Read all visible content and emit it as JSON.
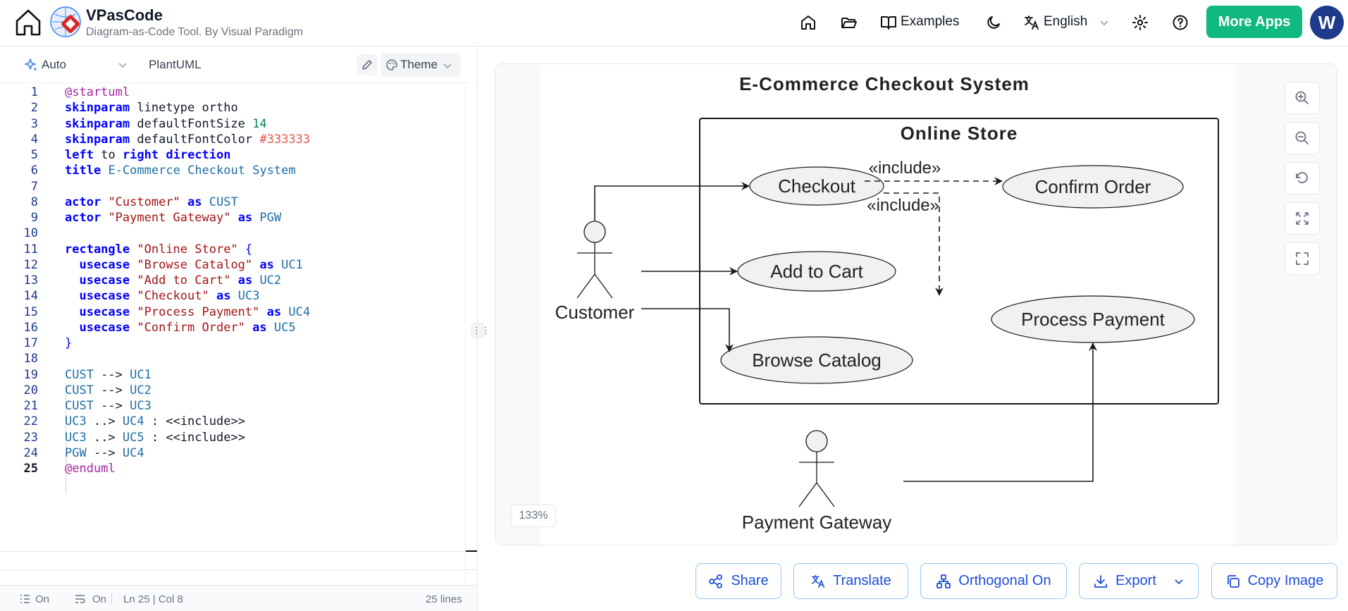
{
  "app": {
    "name": "VPasCode",
    "subtitle": "Diagram-as-Code Tool. By Visual Paradigm"
  },
  "header": {
    "examples_label": "Examples",
    "language_label": "English",
    "more_apps_label": "More Apps",
    "avatar_initial": "W"
  },
  "editor_toolbar": {
    "mode_label": "Auto",
    "language_label": "PlantUML",
    "theme_label": "Theme"
  },
  "code_lines": [
    "@startuml",
    "skinparam linetype ortho",
    "skinparam defaultFontSize 14",
    "skinparam defaultFontColor #333333",
    "left to right direction",
    "title E-Commerce Checkout System",
    "",
    "actor \"Customer\" as CUST",
    "actor \"Payment Gateway\" as PGW",
    "",
    "rectangle \"Online Store\" {",
    "  usecase \"Browse Catalog\" as UC1",
    "  usecase \"Add to Cart\" as UC2",
    "  usecase \"Checkout\" as UC3",
    "  usecase \"Process Payment\" as UC4",
    "  usecase \"Confirm Order\" as UC5",
    "}",
    "",
    "CUST --> UC1",
    "CUST --> UC2",
    "CUST --> UC3",
    "UC3 ..> UC4 : <<include>>",
    "UC3 ..> UC5 : <<include>>",
    "PGW --> UC4",
    "@enduml"
  ],
  "status_bar": {
    "line_numbers": "On",
    "word_wrap": "On",
    "cursor": "Ln 25 | Col 8",
    "line_count": "25 lines"
  },
  "diagram": {
    "title": "E-Commerce Checkout System",
    "boundary": "Online Store",
    "actors": [
      "Customer",
      "Payment Gateway"
    ],
    "use_cases": {
      "checkout": "Checkout",
      "add_to_cart": "Add to Cart",
      "browse_catalog": "Browse Catalog",
      "confirm_order": "Confirm Order",
      "process_payment": "Process Payment"
    },
    "include_label": "«include»"
  },
  "preview": {
    "zoom": "133%"
  },
  "actions": {
    "share": "Share",
    "translate": "Translate",
    "orthogonal": "Orthogonal On",
    "export": "Export",
    "copy_image": "Copy Image"
  },
  "colors": {
    "accent": "#10b981",
    "avatar": "#1e3a8a",
    "action_blue": "#1d4ed8"
  }
}
